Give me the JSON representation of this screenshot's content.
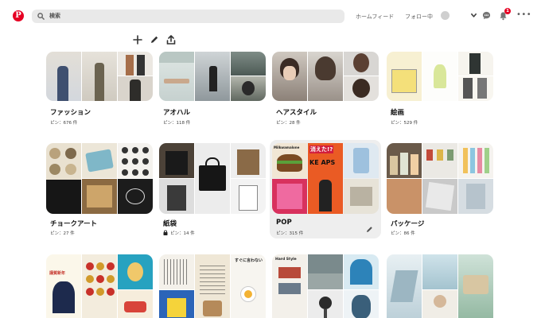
{
  "app": {
    "logo_letter": "P"
  },
  "header": {
    "search_placeholder": "検索",
    "nav_home": "ホームフィード",
    "nav_following": "フォロー中",
    "notification_count": "1"
  },
  "colors": {
    "brand": "#e60023",
    "search_bg": "#e9e9e9",
    "hover_bg": "#eeeeee"
  },
  "toolbar": {
    "icons": [
      "plus-icon",
      "pencil-icon",
      "share-icon"
    ]
  },
  "boards": [
    {
      "name": "ファッション",
      "pins": "ピン：676 件",
      "secret": false
    },
    {
      "name": "アオハル",
      "pins": "ピン：118 件",
      "secret": false
    },
    {
      "name": "ヘアスタイル",
      "pins": "ピン：28 件",
      "secret": false
    },
    {
      "name": "絵画",
      "pins": "ピン：529 件",
      "secret": false
    },
    {
      "name": "チョークアート",
      "pins": "ピン：27 件",
      "secret": false
    },
    {
      "name": "紙袋",
      "pins": "ピン：14 件",
      "secret": true
    },
    {
      "name": "POP",
      "pins": "ピン：315 件",
      "secret": false
    },
    {
      "name": "パッケージ",
      "pins": "ピン：86 件",
      "secret": false
    },
    {
      "name": "",
      "pins": "",
      "secret": false
    },
    {
      "name": "",
      "pins": "",
      "secret": false
    },
    {
      "name": "",
      "pins": "",
      "secret": false
    },
    {
      "name": "",
      "pins": "",
      "secret": false
    }
  ],
  "collage_images": {
    "r1": "",
    "pop_big": "消えた!?",
    "pop_banner": "KE APS",
    "pop_small": "Milkwamalone",
    "poster_a": "謹賀新年",
    "poster_b": "すぐに言わない",
    "poster_c": "Hard Style"
  }
}
